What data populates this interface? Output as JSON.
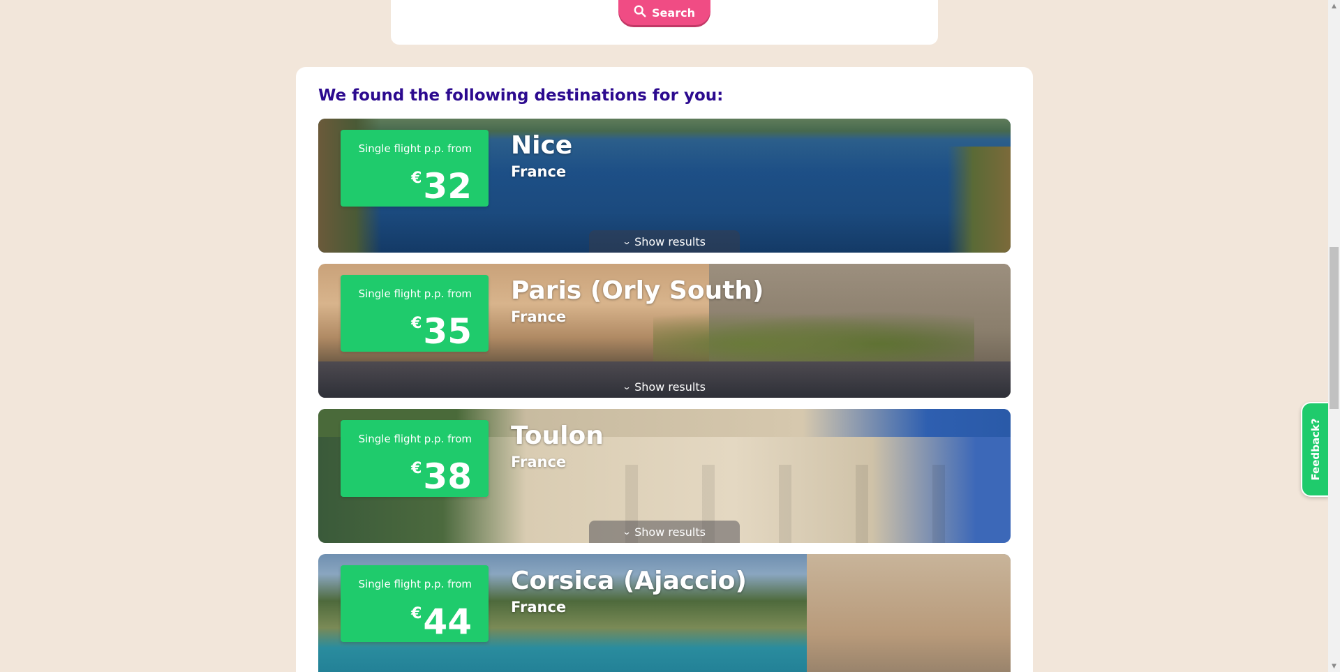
{
  "search": {
    "label": "Search"
  },
  "results": {
    "title": "We found the following destinations for you:",
    "price_label": "Single flight p.p. from",
    "currency": "€",
    "show_results_label": "Show results",
    "destinations": [
      {
        "city": "Nice",
        "country": "France",
        "price": "32"
      },
      {
        "city": "Paris (Orly South)",
        "country": "France",
        "price": "35"
      },
      {
        "city": "Toulon",
        "country": "France",
        "price": "38"
      },
      {
        "city": "Corsica (Ajaccio)",
        "country": "France",
        "price": "44"
      }
    ]
  },
  "feedback": {
    "label": "Feedback?"
  },
  "colors": {
    "page_bg": "#f2e6da",
    "search_button": "#f04c84",
    "title": "#2c0a8f",
    "price_badge": "#1fcb6c"
  }
}
